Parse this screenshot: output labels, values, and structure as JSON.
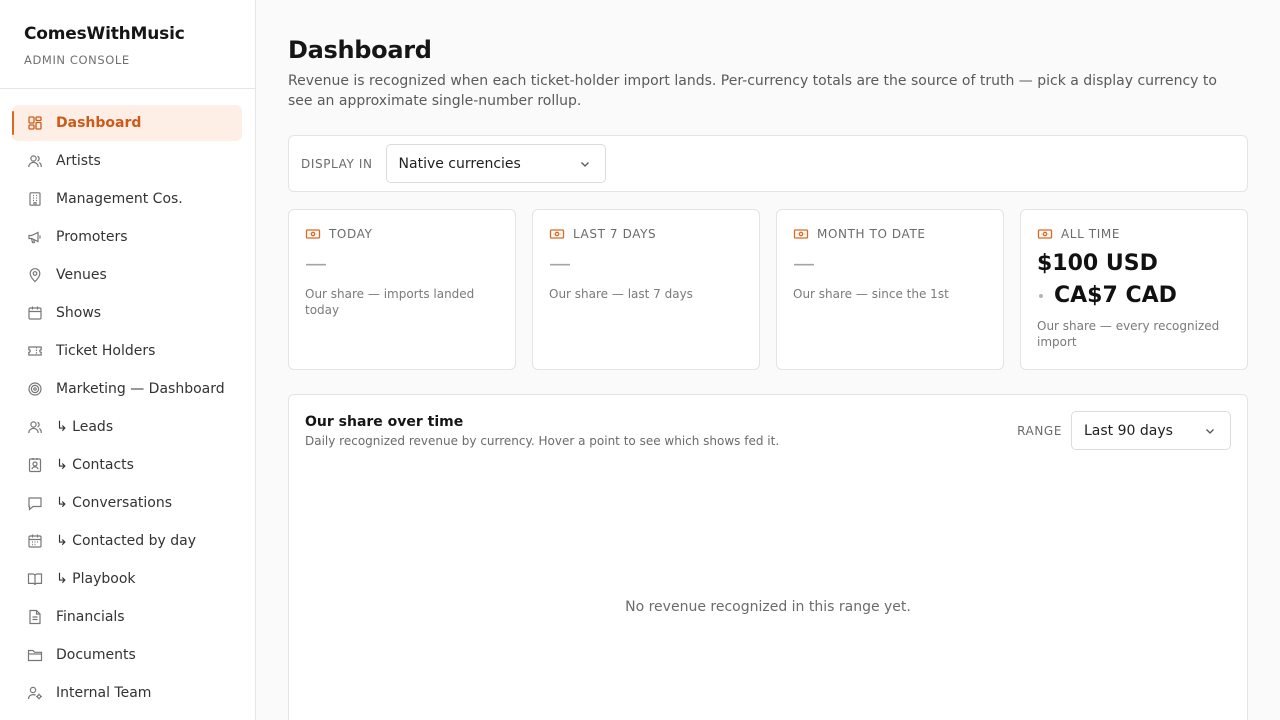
{
  "app": {
    "name": "ComesWithMusic",
    "subtitle": "ADMIN CONSOLE"
  },
  "sidebar": {
    "items": [
      {
        "label": "Dashboard",
        "icon": "dashboard-icon",
        "active": true
      },
      {
        "label": "Artists",
        "icon": "user-icon"
      },
      {
        "label": "Management Cos.",
        "icon": "building-icon"
      },
      {
        "label": "Promoters",
        "icon": "megaphone-icon"
      },
      {
        "label": "Venues",
        "icon": "map-pin-icon"
      },
      {
        "label": "Shows",
        "icon": "calendar-icon"
      },
      {
        "label": "Ticket Holders",
        "icon": "ticket-icon"
      },
      {
        "label": "Marketing — Dashboard",
        "icon": "target-icon"
      },
      {
        "label": "↳ Leads",
        "icon": "users-icon"
      },
      {
        "label": "↳ Contacts",
        "icon": "contact-icon"
      },
      {
        "label": "↳ Conversations",
        "icon": "message-icon"
      },
      {
        "label": "↳ Contacted by day",
        "icon": "calendar-days-icon"
      },
      {
        "label": "↳ Playbook",
        "icon": "book-icon"
      },
      {
        "label": "Financials",
        "icon": "file-text-icon"
      },
      {
        "label": "Documents",
        "icon": "folder-icon"
      },
      {
        "label": "Internal Team",
        "icon": "user-cog-icon"
      }
    ]
  },
  "main": {
    "title": "Dashboard",
    "description": "Revenue is recognized when each ticket-holder import lands. Per-currency totals are the source of truth — pick a display currency to see an approximate single-number rollup.",
    "display_in": {
      "label": "DISPLAY IN",
      "selected": "Native currencies"
    },
    "cards": [
      {
        "label": "TODAY",
        "value": "—",
        "note": "Our share — imports landed today"
      },
      {
        "label": "LAST 7 DAYS",
        "value": "—",
        "note": "Our share — last 7 days"
      },
      {
        "label": "MONTH TO DATE",
        "value": "—",
        "note": "Our share — since the 1st"
      },
      {
        "label": "ALL TIME",
        "amounts": [
          "$100 USD",
          "CA$7 CAD"
        ],
        "note": "Our share — every recognized import"
      }
    ],
    "chart": {
      "title": "Our share over time",
      "subtitle": "Daily recognized revenue by currency. Hover a point to see which shows fed it.",
      "range_label": "RANGE",
      "range_selected": "Last 90 days",
      "empty_message": "No revenue recognized in this range yet."
    }
  },
  "colors": {
    "accent": "#e0671f",
    "accent_bg": "#fdefe6"
  }
}
